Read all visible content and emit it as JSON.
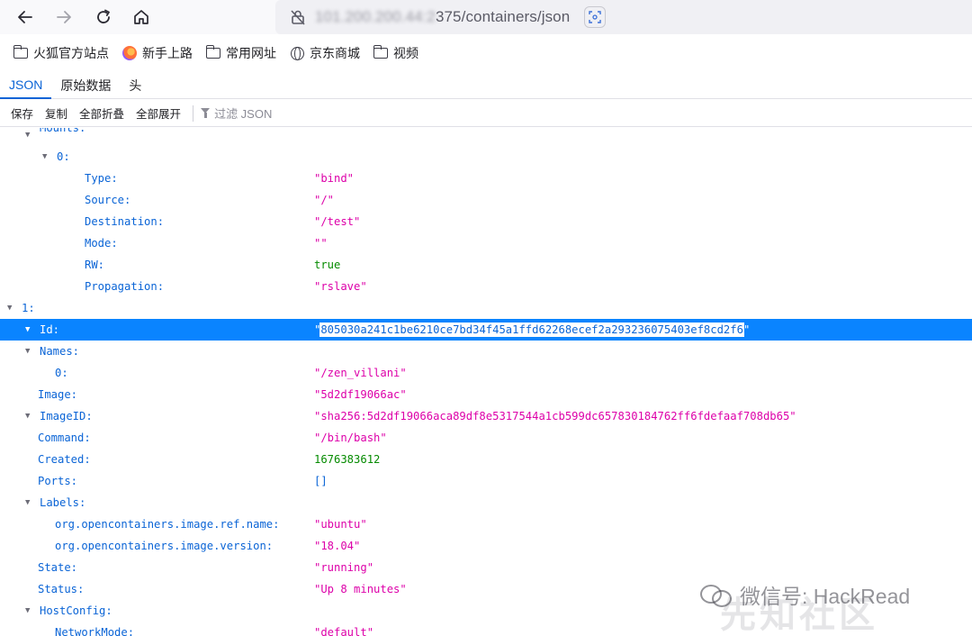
{
  "browser": {
    "url_hidden_part": "101.200.200.44:2",
    "url_visible_part": "375/containers/json"
  },
  "bookmarks": [
    {
      "icon": "folder-icon",
      "label": "火狐官方站点"
    },
    {
      "icon": "firefox-icon",
      "label": "新手上路"
    },
    {
      "icon": "folder-icon",
      "label": "常用网址"
    },
    {
      "icon": "globe-icon",
      "label": "京东商城"
    },
    {
      "icon": "folder-icon",
      "label": "视频"
    }
  ],
  "viewer_tabs": [
    "JSON",
    "原始数据",
    "头"
  ],
  "actions": {
    "save": "保存",
    "copy": "复制",
    "collapse_all": "全部折叠",
    "expand_all": "全部展开",
    "filter_placeholder": "过滤 JSON"
  },
  "tree": [
    {
      "key": "Mounts:",
      "value": "",
      "type": "none",
      "indent": 1,
      "toggle": true,
      "partial": true
    },
    {
      "key": "0:",
      "value": "",
      "type": "none",
      "indent": 2,
      "toggle": true
    },
    {
      "key": "Type:",
      "value": "\"bind\"",
      "type": "str",
      "indent": 3
    },
    {
      "key": "Source:",
      "value": "\"/\"",
      "type": "str",
      "indent": 3
    },
    {
      "key": "Destination:",
      "value": "\"/test\"",
      "type": "str",
      "indent": 3
    },
    {
      "key": "Mode:",
      "value": "\"\"",
      "type": "str",
      "indent": 3
    },
    {
      "key": "RW:",
      "value": "true",
      "type": "bool",
      "indent": 3
    },
    {
      "key": "Propagation:",
      "value": "\"rslave\"",
      "type": "str",
      "indent": 3
    },
    {
      "key": "1:",
      "value": "",
      "type": "none",
      "indent": 0,
      "toggle": true
    },
    {
      "key": "Id:",
      "value": "805030a241c1be6210ce7bd34f45a1ffd62268ecef2a293236075403ef8cd2f6",
      "type": "str",
      "indent": 1,
      "toggle": true,
      "selected": true
    },
    {
      "key": "Names:",
      "value": "",
      "type": "none",
      "indent": 1,
      "toggle": true
    },
    {
      "key": "0:",
      "value": "\"/zen_villani\"",
      "type": "str",
      "indent": 2
    },
    {
      "key": "Image:",
      "value": "\"5d2df19066ac\"",
      "type": "str",
      "indent": 1
    },
    {
      "key": "ImageID:",
      "value": "\"sha256:5d2df19066aca89df8e5317544a1cb599dc657830184762ff6fdefaaf708db65\"",
      "type": "str",
      "indent": 1,
      "toggle": true
    },
    {
      "key": "Command:",
      "value": "\"/bin/bash\"",
      "type": "str",
      "indent": 1
    },
    {
      "key": "Created:",
      "value": "1676383612",
      "type": "num",
      "indent": 1
    },
    {
      "key": "Ports:",
      "value": "[]",
      "type": "arr",
      "indent": 1
    },
    {
      "key": "Labels:",
      "value": "",
      "type": "none",
      "indent": 1,
      "toggle": true
    },
    {
      "key": "org.opencontainers.image.ref.name:",
      "value": "\"ubuntu\"",
      "type": "str",
      "indent": 2
    },
    {
      "key": "org.opencontainers.image.version:",
      "value": "\"18.04\"",
      "type": "str",
      "indent": 2
    },
    {
      "key": "State:",
      "value": "\"running\"",
      "type": "str",
      "indent": 1
    },
    {
      "key": "Status:",
      "value": "\"Up 8 minutes\"",
      "type": "str",
      "indent": 1
    },
    {
      "key": "HostConfig:",
      "value": "",
      "type": "none",
      "indent": 1,
      "toggle": true
    },
    {
      "key": "NetworkMode:",
      "value": "\"default\"",
      "type": "str",
      "indent": 2
    }
  ],
  "watermark": {
    "line1": "微信号: HackRead",
    "line2": "先知社区"
  }
}
